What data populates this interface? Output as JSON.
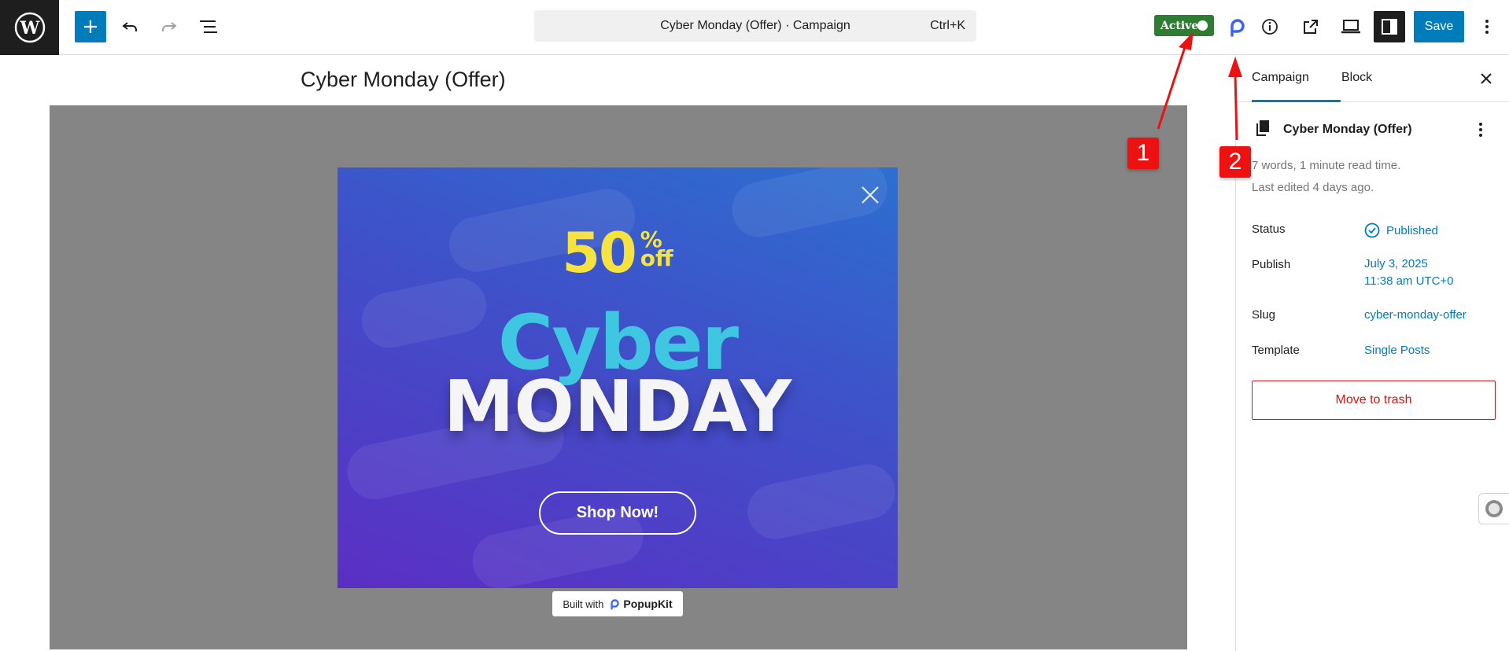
{
  "topbar": {
    "command_bar_text": "Cyber Monday (Offer) · Campaign",
    "command_shortcut": "Ctrl+K",
    "active_label": "Active",
    "save_label": "Save"
  },
  "editor": {
    "post_title": "Cyber Monday (Offer)"
  },
  "popup": {
    "discount_number": "50",
    "discount_percent": "%",
    "discount_off": "off",
    "headline_1": "Cyber",
    "headline_2": "MONDAY",
    "cta_label": "Shop Now!",
    "built_with_label": "Built with",
    "brand_name": "PopupKit",
    "colors": {
      "yellow": "#f6e340",
      "cyan": "#3fc6e0",
      "gradient_top": "#2d6fd0",
      "gradient_bottom": "#5b2fc4"
    }
  },
  "sidebar": {
    "tabs": [
      {
        "label": "Campaign",
        "active": true
      },
      {
        "label": "Block",
        "active": false
      }
    ],
    "document_title": "Cyber Monday (Offer)",
    "word_count": "7 words, 1 minute read time.",
    "last_edited": "Last edited 4 days ago.",
    "rows": [
      {
        "label": "Status",
        "value": "Published"
      },
      {
        "label": "Publish",
        "value": "July 3, 2025",
        "value_2": "11:38 am UTC+0"
      },
      {
        "label": "Slug",
        "value": "cyber-monday-offer"
      },
      {
        "label": "Template",
        "value": "Single Posts"
      }
    ],
    "trash_label": "Move to trash"
  },
  "annotations": {
    "marker_1": "1",
    "marker_2": "2"
  },
  "accent_color": "#007cba"
}
